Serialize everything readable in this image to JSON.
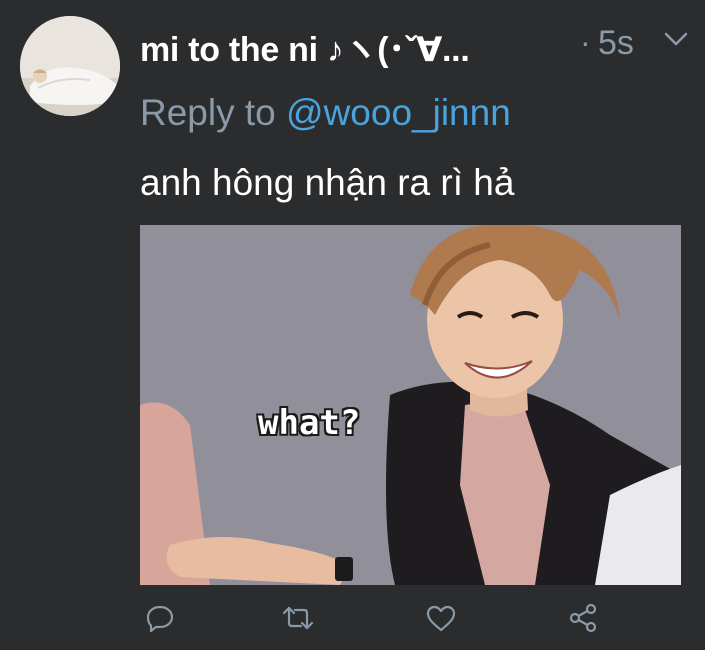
{
  "tweet": {
    "display_name": "mi to the ni ♪ヽ(･ˇ∀...",
    "separator": "·",
    "timestamp": "5s",
    "reply_prefix": "Reply to",
    "reply_handle": "@wooo_jinnn",
    "text": "anh hông nhận ra rì hả",
    "media": {
      "caption": "what?"
    }
  },
  "icons": {
    "avatar": "avatar-photo",
    "more": "chevron-down-icon",
    "reply": "reply-icon",
    "retweet": "retweet-icon",
    "like": "heart-icon",
    "share": "share-icon"
  },
  "colors": {
    "background": "#2b2c2e",
    "text_primary": "#ffffff",
    "text_secondary": "#8a9aa8",
    "link": "#4aa3df",
    "icon": "#8a9aa8"
  }
}
